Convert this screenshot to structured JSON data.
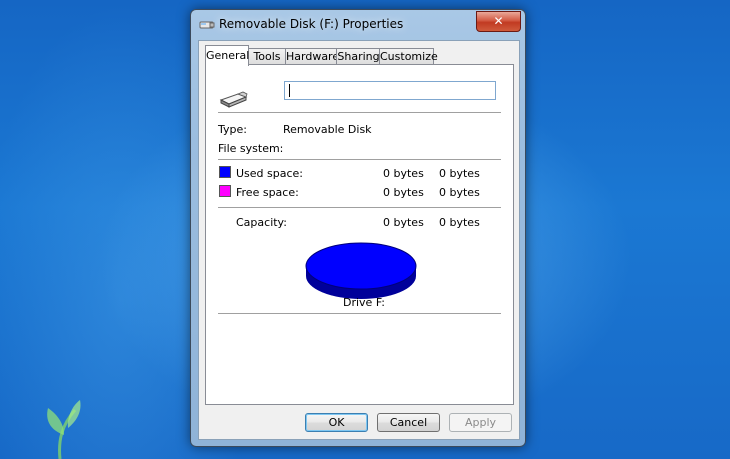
{
  "window": {
    "title": "Removable Disk (F:) Properties",
    "close_glyph": "✕"
  },
  "tabs": [
    {
      "label": "General",
      "active": true
    },
    {
      "label": "Tools",
      "active": false
    },
    {
      "label": "Hardware",
      "active": false
    },
    {
      "label": "Sharing",
      "active": false
    },
    {
      "label": "Customize",
      "active": false
    }
  ],
  "general": {
    "drive_icon": "removable-drive-icon",
    "name_value": "",
    "type_label": "Type:",
    "type_value": "Removable Disk",
    "fs_label": "File system:",
    "fs_value": "",
    "used_label": "Used space:",
    "used_bytes": "0 bytes",
    "used_size": "0 bytes",
    "free_label": "Free space:",
    "free_bytes": "0 bytes",
    "free_size": "0 bytes",
    "capacity_label": "Capacity:",
    "capacity_bytes": "0 bytes",
    "capacity_size": "0 bytes",
    "drive_label": "Drive F:"
  },
  "colors": {
    "used": "#0000ff",
    "free": "#ff00ff",
    "used_dark": "#00009a"
  },
  "buttons": {
    "ok": "OK",
    "cancel": "Cancel",
    "apply": "Apply"
  }
}
